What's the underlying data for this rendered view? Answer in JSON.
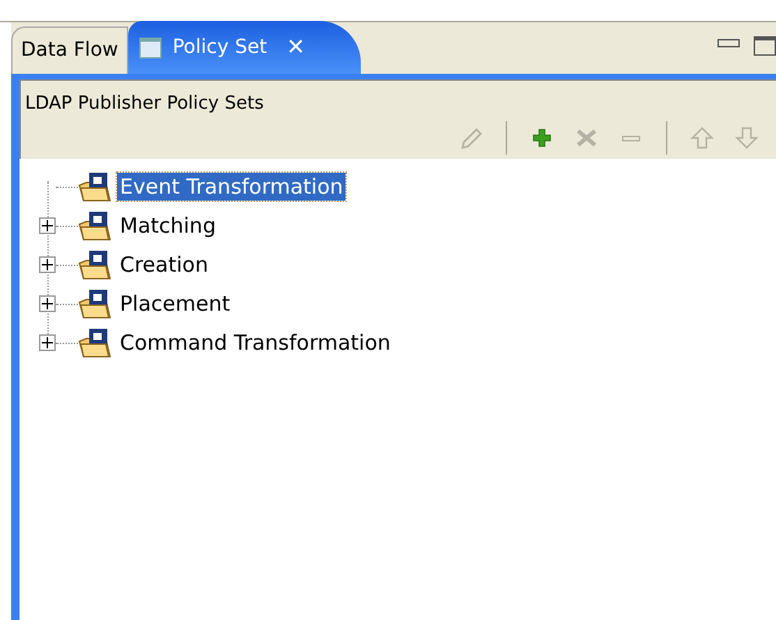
{
  "tabs": [
    {
      "label": "Data Flow",
      "selected": false,
      "closable": false
    },
    {
      "label": "Policy Set",
      "selected": true,
      "closable": true
    }
  ],
  "close_glyph": "✕",
  "panel": {
    "title": "LDAP Publisher Policy Sets"
  },
  "toolbar": [
    {
      "kind": "edit",
      "disabled": true
    },
    {
      "kind": "separator"
    },
    {
      "kind": "add",
      "disabled": false
    },
    {
      "kind": "remove-all",
      "disabled": true
    },
    {
      "kind": "remove",
      "disabled": true
    },
    {
      "kind": "separator"
    },
    {
      "kind": "up",
      "disabled": true
    },
    {
      "kind": "down",
      "disabled": true
    }
  ],
  "tree": [
    {
      "label": "Event Transformation",
      "kind": "leaf",
      "selected": true
    },
    {
      "label": "Matching",
      "kind": "branch",
      "selected": false
    },
    {
      "label": "Creation",
      "kind": "branch",
      "selected": false
    },
    {
      "label": "Placement",
      "kind": "branch",
      "selected": false
    },
    {
      "label": "Command Transformation",
      "kind": "branch",
      "selected": false
    }
  ]
}
